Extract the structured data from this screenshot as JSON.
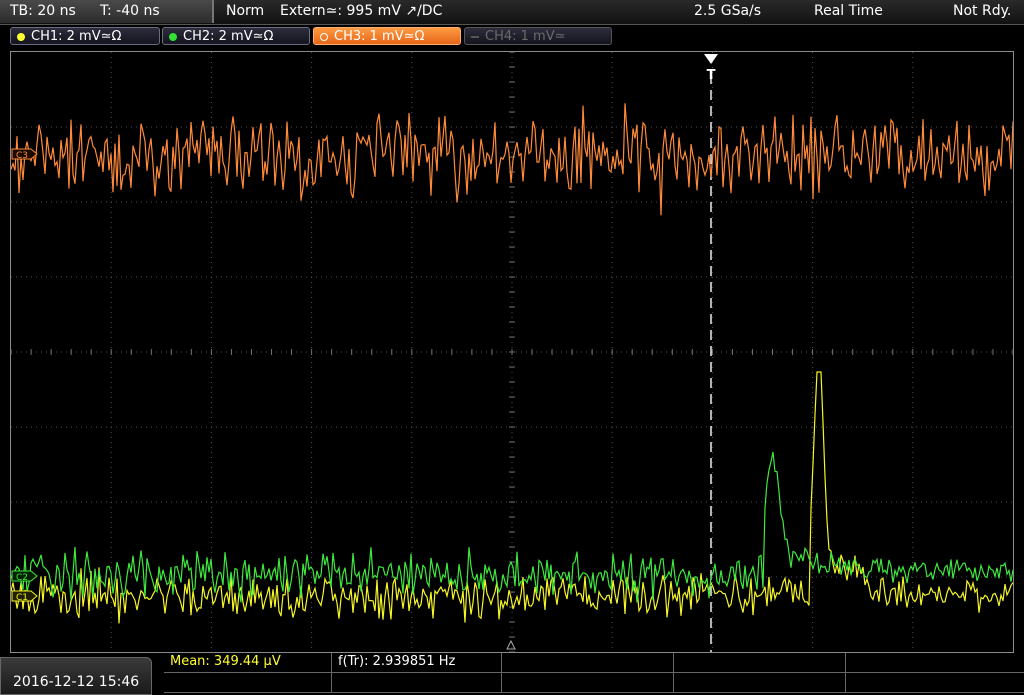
{
  "topbar": {
    "tb": "TB: 20 ns",
    "t": "T: -40 ns",
    "mode": "Norm",
    "trigger": "Extern≃: 995 mV ↗/DC",
    "rate": "2.5 GSa/s",
    "acq": "Real Time",
    "status": "Not Rdy."
  },
  "channels": [
    {
      "label": "CH1: 2 mV≃Ω",
      "color": "#ffff33",
      "state": "on"
    },
    {
      "label": "CH2: 2 mV≃Ω",
      "color": "#33e033",
      "state": "on"
    },
    {
      "label": "CH3: 1 mV≃Ω",
      "color": "#ff8c33",
      "state": "active"
    },
    {
      "label": "CH4: 1 mV≃",
      "color": "#666666",
      "state": "off"
    }
  ],
  "markers": {
    "ch3": "C3",
    "ch2": "C2",
    "ch1": "C1",
    "trigger": "T"
  },
  "bottom": {
    "datetime": "2016-12-12 15:46",
    "mean": "Mean: 349.44 µV",
    "freq": "f(Tr): 2.939851 Hz"
  },
  "colors": {
    "ch1": "#f5f528",
    "ch2": "#3ee83e",
    "ch3": "#ff8a3a",
    "grid": "#505050"
  }
}
